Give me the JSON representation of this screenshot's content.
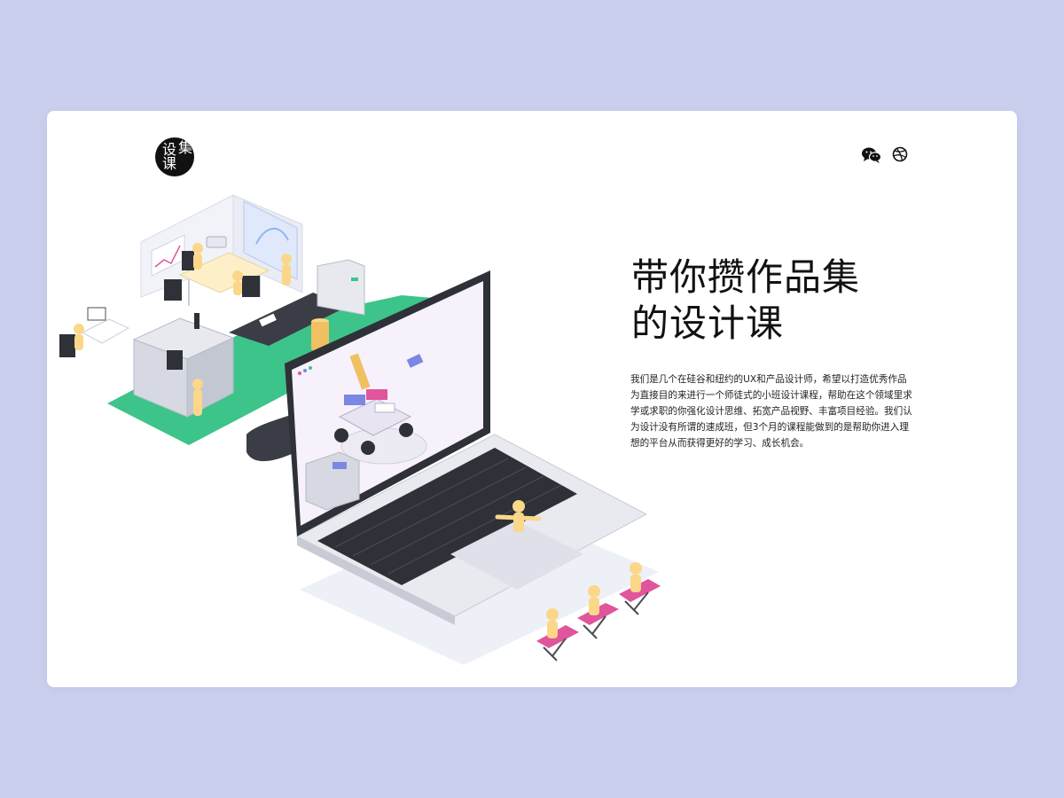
{
  "logo": {
    "char1": "设",
    "char2": "集",
    "char3": "课"
  },
  "social": {
    "wechat_icon": "wechat-icon",
    "dribbble_icon": "dribbble-icon"
  },
  "hero": {
    "title_line1": "带你攒作品集",
    "title_line2": "的设计课",
    "description": "我们是几个在硅谷和纽约的UX和产品设计师，希望以打造优秀作品为直接目的来进行一个师徒式的小班设计课程，帮助在这个领域里求学或求职的你强化设计思维、拓宽产品视野、丰富项目经验。我们认为设计没有所谓的速成班，但3个月的课程能做到的是帮助你进入理想的平台从而获得更好的学习、成长机会。"
  },
  "colors": {
    "background": "#cbcfee",
    "card": "#ffffff",
    "floor_green": "#3cc48a",
    "conveyor": "#3a3d45",
    "figure_yellow": "#fbd78a",
    "accent_pink": "#e0559b",
    "accent_blue": "#7c86e3"
  }
}
